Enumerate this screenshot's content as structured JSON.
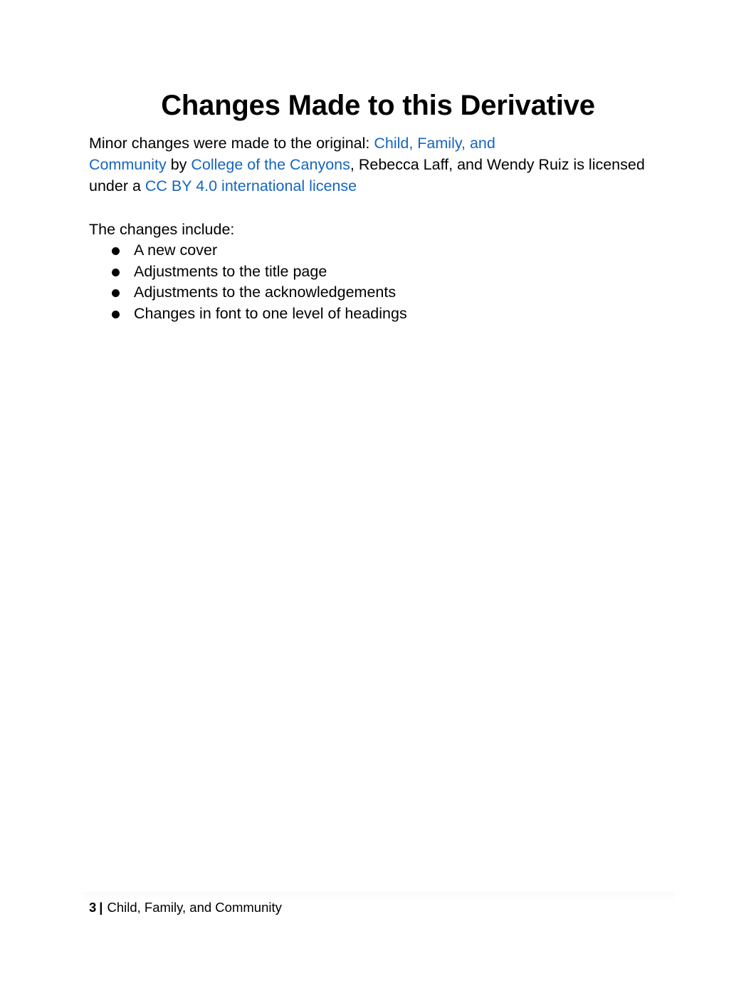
{
  "page": {
    "title": "Changes Made to this Derivative",
    "paragraph": {
      "line1_text": "Minor changes were made to the original: ",
      "link_book_part1": "Child, Family, and",
      "link_book_part2": "Community",
      "by_text": " by ",
      "link_college": "College of the Canyons",
      "authors_text": ", Rebecca Laff, and Wendy Ruiz is licensed",
      "line3_text": "under a ",
      "link_license": "CC BY 4.0 international license"
    },
    "changes_intro": "The changes include:",
    "changes": [
      "A new cover",
      "Adjustments to the title page",
      "Adjustments to the acknowledgements",
      "Changes in font to one level of headings"
    ],
    "footer": {
      "page_number": "3",
      "separator": "|",
      "book_title": "Child, Family, and Community"
    }
  },
  "colors": {
    "link": "#1565c0",
    "text": "#000000"
  }
}
